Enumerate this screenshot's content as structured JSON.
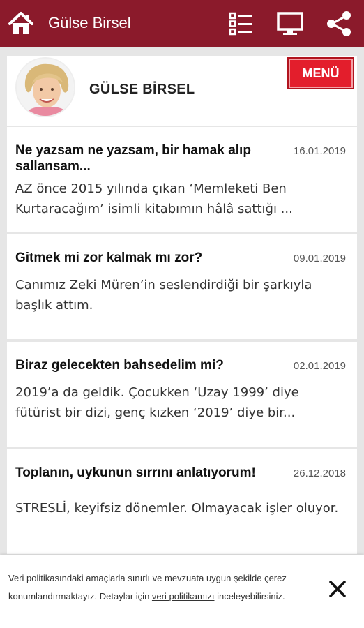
{
  "header": {
    "title": "Gülse Birsel",
    "icons": [
      "home-icon",
      "list-icon",
      "monitor-icon",
      "share-icon"
    ],
    "background_color": "#8b1a2b"
  },
  "profile": {
    "name": "GÜLSE BİRSEL",
    "menu_label": "MENÜ",
    "menu_color": "#e31e2c"
  },
  "articles": [
    {
      "title": "Ne yazsam ne yazsam, bir hamak alıp sallansam...",
      "date": "16.01.2019",
      "excerpt": "AZ önce 2015 yılında çıkan ‘Memleketi Ben Kurtaracağım’ isimli kitabımın hâlâ sattığı ..."
    },
    {
      "title": "Gitmek mi zor kalmak mı zor?",
      "date": "09.01.2019",
      "excerpt": "Canımız Zeki Müren’in seslendirdiği bir şarkıyla başlık attım."
    },
    {
      "title": "Biraz gelecekten bahsedelim mi?",
      "date": "02.01.2019",
      "excerpt": "2019’a da geldik. Çocukken ‘Uzay 1999’ diye fütürist bir dizi, genç kızken ‘2019’ diye bir..."
    },
    {
      "title": "Toplanın, uykunun sırrını anlatıyorum!",
      "date": "26.12.2018",
      "excerpt": "STRESLİ, keyifsiz dönemler. Olmayacak işler oluyor."
    }
  ],
  "cookie": {
    "text_before": "Veri politikasındaki amaçlarla sınırlı ve mevzuata uygun şekilde çerez konumlandırmaktayız. Detaylar için ",
    "link_text": "veri politikamızı",
    "text_after": " inceleyebilirsiniz."
  }
}
